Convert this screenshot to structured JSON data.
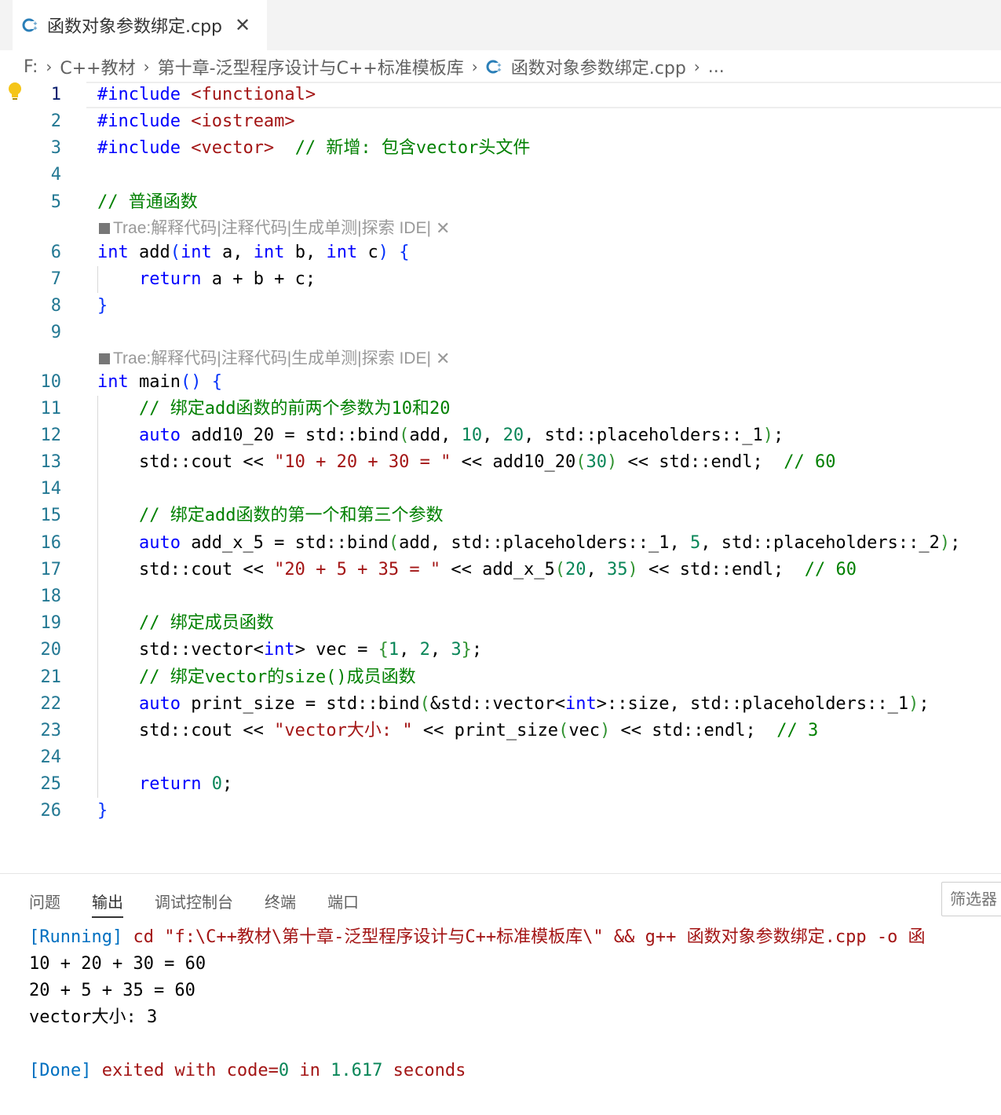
{
  "tab": {
    "title": "函数对象参数绑定.cpp",
    "close": "✕",
    "icon": "cpp-file-icon"
  },
  "breadcrumb": [
    "F:",
    "C++教材",
    "第十章-泛型程序设计与C++标准模板库",
    "函数对象参数绑定.cpp",
    "..."
  ],
  "breadcrumb_sep": "›",
  "codelens": {
    "prefix": "Trae: ",
    "actions": [
      "解释代码",
      "注释代码",
      "生成单测",
      "探索 IDE"
    ],
    "separator": " | ",
    "close": "✕"
  },
  "code": {
    "l1": {
      "a": "#include",
      "b": "<functional>"
    },
    "l2": {
      "a": "#include",
      "b": "<iostream>"
    },
    "l3": {
      "a": "#include",
      "b": "<vector>",
      "c": "// 新增: 包含vector头文件"
    },
    "l5": {
      "c": "// 普通函数"
    },
    "l6": {
      "a": "int",
      "b": " add",
      "c": "(",
      "d": "int",
      "e": " a, ",
      "f": "int",
      "g": " b, ",
      "h": "int",
      "i": " c",
      "j": ")",
      "k": " {"
    },
    "l7": {
      "a": "return",
      "b": " a + b + c;"
    },
    "l8": {
      "a": "}"
    },
    "l10": {
      "a": "int",
      "b": " main",
      "c": "()",
      "d": " {"
    },
    "l11": {
      "c": "// 绑定add函数的前两个参数为10和20"
    },
    "l12": {
      "a": "auto",
      "b": " add10_20 = std::bind",
      "c": "(",
      "d": "add, ",
      "e": "10",
      "f": ", ",
      "g": "20",
      "h": ", std::placeholders::_1",
      "i": ")",
      "j": ";"
    },
    "l13": {
      "a": "std::cout << ",
      "b": "\"10 + 20 + 30 = \"",
      "c": " << add10_20",
      "d": "(",
      "e": "30",
      "f": ")",
      "g": " << std::endl;  ",
      "h": "// 60"
    },
    "l15": {
      "c": "// 绑定add函数的第一个和第三个参数"
    },
    "l16": {
      "a": "auto",
      "b": " add_x_5 = std::bind",
      "c": "(",
      "d": "add, std::placeholders::_1, ",
      "e": "5",
      "f": ", std::placeholders::_2",
      "g": ")",
      "h": ";"
    },
    "l17": {
      "a": "std::cout << ",
      "b": "\"20 + 5 + 35 = \"",
      "c": " << add_x_5",
      "d": "(",
      "e": "20",
      "f": ", ",
      "g": "35",
      "h": ")",
      "i": " << std::endl;  ",
      "j": "// 60"
    },
    "l19": {
      "c": "// 绑定成员函数"
    },
    "l20": {
      "a": "std::vector<",
      "b": "int",
      "c": "> vec = ",
      "d": "{",
      "e": "1",
      "f": ", ",
      "g": "2",
      "h": ", ",
      "i": "3",
      "j": "}",
      "k": ";"
    },
    "l21": {
      "c": "// 绑定vector的size()成员函数"
    },
    "l22": {
      "a": "auto",
      "b": " print_size = std::bind",
      "c": "(",
      "d": "&std::vector<",
      "e": "int",
      "f": ">::size, std::placeholders::_1",
      "g": ")",
      "h": ";"
    },
    "l23": {
      "a": "std::cout << ",
      "b": "\"vector大小: \"",
      "c": " << print_size",
      "d": "(",
      "e": "vec",
      "f": ")",
      "g": " << std::endl;  ",
      "h": "// 3"
    },
    "l25": {
      "a": "return",
      "b": " ",
      "c": "0",
      "d": ";"
    },
    "l26": {
      "a": "}"
    }
  },
  "line_numbers": [
    "1",
    "2",
    "3",
    "4",
    "5",
    "6",
    "7",
    "8",
    "9",
    "10",
    "11",
    "12",
    "13",
    "14",
    "15",
    "16",
    "17",
    "18",
    "19",
    "20",
    "21",
    "22",
    "23",
    "24",
    "25",
    "26"
  ],
  "panel": {
    "tabs": [
      "问题",
      "输出",
      "调试控制台",
      "终端",
      "端口"
    ],
    "active_tab": "输出",
    "filter_placeholder": "筛选器",
    "output": {
      "running_tag": "[Running]",
      "running_cmd": " cd \"f:\\C++教材\\第十章-泛型程序设计与C++标准模板库\\\" && g++ 函数对象参数绑定.cpp -o 函",
      "line2": "10 + 20 + 30 = 60",
      "line3": "20 + 5 + 35 = 60",
      "line4": "vector大小: 3",
      "done_tag": "[Done]",
      "done_a": " exited with ",
      "done_b": "code=",
      "done_c": "0",
      "done_d": " in ",
      "done_e": "1.617",
      "done_f": " seconds"
    }
  },
  "colors": {
    "keyword": "#0000ff",
    "comment": "#008000",
    "string": "#a31515",
    "number": "#098658",
    "line_number": "#237893"
  }
}
